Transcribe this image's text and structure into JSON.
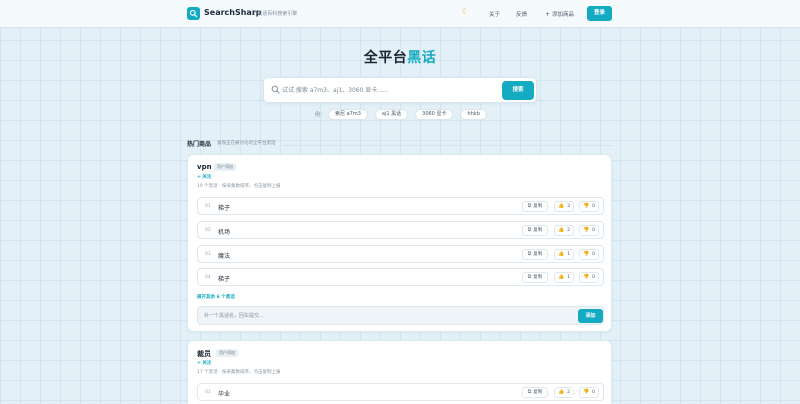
{
  "header": {
    "brand": "SearchSharp",
    "slogan": "/  黑话百科搜索引擎",
    "about": "关于",
    "feedback": "反馈",
    "add": "添加商品",
    "login": "登录"
  },
  "hero": {
    "title": "全平台",
    "title_accent": "黑话",
    "search_placeholder": "试试 搜索 a7m3、aj1、3060 显卡......",
    "search_button": "搜索",
    "examples_label": "例：",
    "examples": [
      "索尼 a7m3",
      "aj1 黑话",
      "3060 显卡",
      "hhkb"
    ]
  },
  "section": {
    "title": "热门商品",
    "subtitle": "发现正在被讨论的全平台黑话"
  },
  "cards": [
    {
      "title": "vpn",
      "badge": "用户添加",
      "follow": "+ 关注",
      "meta": "10 个黑话  ·  按采集数排序，点击复制上报",
      "entries": [
        {
          "num": "01",
          "word": "梯子",
          "copy": "复制",
          "up": "3",
          "down": "0"
        },
        {
          "num": "02",
          "word": "机场",
          "copy": "复制",
          "up": "2",
          "down": "0"
        },
        {
          "num": "03",
          "word": "魔法",
          "copy": "复制",
          "up": "1",
          "down": "0"
        },
        {
          "num": "04",
          "word": "梯子",
          "copy": "复制",
          "up": "1",
          "down": "0"
        }
      ],
      "expand": "展开其余 6 个黑话",
      "submit_placeholder": "补一个黑话名，回车提交...",
      "submit_button": "添加"
    },
    {
      "title": "裁员",
      "badge": "用户添加",
      "follow": "+ 关注",
      "meta": "17 个黑话  ·  按采集数排序，点击复制上报",
      "entries": [
        {
          "num": "01",
          "word": "毕业",
          "copy": "复制",
          "up": "2",
          "down": "0"
        }
      ]
    }
  ],
  "colors": {
    "accent": "#13aac2",
    "background": "#e3f0f8",
    "thumb_down": "#e0a020"
  },
  "icons": [
    "logo-search-icon",
    "moon-icon",
    "plus-icon",
    "search-icon",
    "copy-icon",
    "thumbs-up-icon",
    "thumbs-down-icon"
  ]
}
